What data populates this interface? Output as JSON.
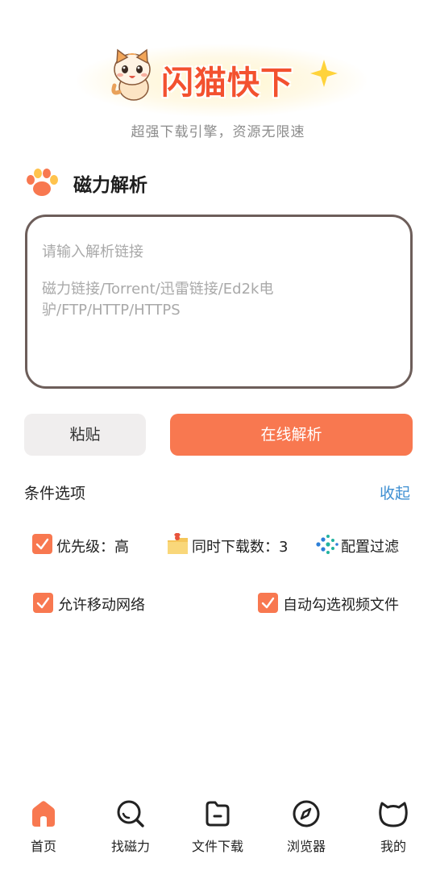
{
  "header": {
    "app_title": "闪猫快下",
    "tagline": "超强下载引擎，资源无限速"
  },
  "section": {
    "title": "磁力解析"
  },
  "input": {
    "placeholder": "请输入解析链接",
    "hint": "磁力链接/Torrent/迅雷链接/Ed2k电驴/FTP/HTTP/HTTPS"
  },
  "actions": {
    "paste_label": "粘贴",
    "parse_label": "在线解析"
  },
  "options": {
    "title": "条件选项",
    "collapse_label": "收起",
    "priority_label": "优先级：高",
    "concurrent_label": "同时下载数：3",
    "filter_label": "配置过滤",
    "mobile_network_label": "允许移动网络",
    "auto_select_label": "自动勾选视频文件",
    "mobile_network_checked": true,
    "auto_select_checked": true,
    "priority_checked": true
  },
  "nav": {
    "items": [
      {
        "label": "首页",
        "icon": "home-icon",
        "active": true
      },
      {
        "label": "找磁力",
        "icon": "search-icon",
        "active": false
      },
      {
        "label": "文件下载",
        "icon": "folder-icon",
        "active": false
      },
      {
        "label": "浏览器",
        "icon": "compass-icon",
        "active": false
      },
      {
        "label": "我的",
        "icon": "cat-face-icon",
        "active": false
      }
    ]
  },
  "colors": {
    "accent": "#f87850",
    "title_red": "#f3512f",
    "link_blue": "#3e8fd2"
  }
}
